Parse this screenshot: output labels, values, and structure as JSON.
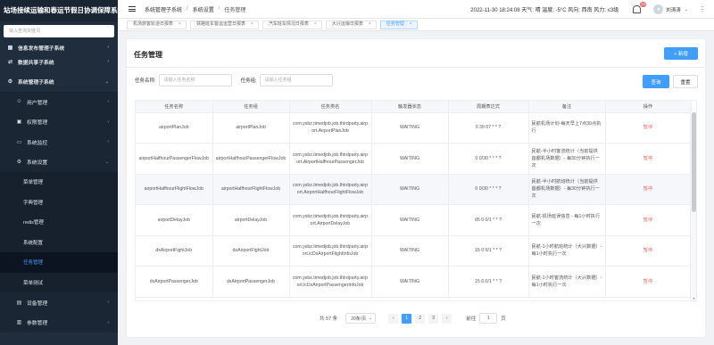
{
  "app": {
    "brand": "站场接续运输和春运节假日协调保障系统"
  },
  "sidebar": {
    "search_placeholder": "输入查询关键词",
    "items": [
      {
        "label": "信息发布管理子系统",
        "icon": "grid-icon",
        "level": 1,
        "chev": "›"
      },
      {
        "label": "数据共享子系统",
        "icon": "share-icon",
        "level": 1,
        "chev": "›"
      },
      {
        "label": "系统管理子系统",
        "icon": "gear-icon",
        "level": 1,
        "chev": "⌄"
      },
      {
        "label": "用户管理",
        "icon": "user-icon",
        "level": 2,
        "chev": "›"
      },
      {
        "label": "权限管理",
        "icon": "lock-icon",
        "level": 2,
        "chev": "›"
      },
      {
        "label": "系统监控",
        "icon": "monitor-icon",
        "level": 2,
        "chev": "›"
      },
      {
        "label": "系统设置",
        "icon": "settings-icon",
        "level": 2,
        "chev": "⌄"
      },
      {
        "label": "菜单管理",
        "level": 3
      },
      {
        "label": "字典管理",
        "level": 3
      },
      {
        "label": "redis管理",
        "level": 3
      },
      {
        "label": "系统配置",
        "level": 3
      },
      {
        "label": "任务管理",
        "level": 3,
        "active": true
      },
      {
        "label": "菜单测试",
        "level": 3
      },
      {
        "label": "设备管理",
        "icon": "device-icon",
        "level": 2,
        "chev": "›"
      },
      {
        "label": "参数管理",
        "icon": "param-icon",
        "level": 2,
        "chev": "›"
      }
    ]
  },
  "topbar": {
    "breadcrumb": [
      "系统管理子系统",
      "系统设置",
      "任务管理"
    ],
    "status": "2022-11-30 18:24:08  天气: 晴 温度: -5°C 风向: 西南 风力: ≤3级",
    "badge": "25",
    "username": "刘涛涛"
  },
  "tabs": [
    {
      "label": "机场旅客轨道日报表"
    },
    {
      "label": "铁路班车客运运营日报表"
    },
    {
      "label": "汽车班车情况日报表"
    },
    {
      "label": "大兴运输日报表"
    },
    {
      "label": "任务管理",
      "active": true
    }
  ],
  "page": {
    "title": "任务管理",
    "add_label": "+ 新增",
    "filter": {
      "name_label": "任务名称:",
      "name_placeholder": "请输入任务名称",
      "group_label": "任务组:",
      "group_placeholder": "请输入任务组",
      "query_label": "查询",
      "reset_label": "重置"
    }
  },
  "table": {
    "columns": [
      "任务名称",
      "任务组",
      "任务类名",
      "触发器状态",
      "周期表达式",
      "备注",
      "操作"
    ],
    "rows": [
      {
        "name": "airportPlanJob",
        "group": "airportPlanJob",
        "cls": "com.ysbz.timedjob.job.thirdparty.airport.AirportPlanJob",
        "state": "WAITING",
        "cron": "0 30 07 * * ?",
        "remark": "民航机场计划-每天早上7点30点执行",
        "op": "暂停"
      },
      {
        "name": "airportHalfhourPassengerFlowJob",
        "group": "airportHalfhourPassengerFlowJob",
        "cls": "com.ysbz.timedjob.job.thirdparty.airport.AirportHalfhourPassengerJob",
        "state": "WAITING",
        "cron": "0 0/30 * * * ?",
        "remark": "民航-半小时客流统计（当前提供首都机场数据）- 每30分钟执行一次",
        "op": "暂停"
      },
      {
        "name": "airportHalfhourFlightFlowJob",
        "group": "airportHalfhourFlightFlowJob",
        "cls": "com.ysbz.timedjob.job.thirdparty.airport.AirportHalfhourFlightFlowJob",
        "state": "WAITING",
        "cron": "0 0/30 * * * ?",
        "remark": "民航-半小时航班统计（当前提供首都机场数据）- 每30分钟执行一次",
        "op": "暂停",
        "hl": true
      },
      {
        "name": "airportDelayJob",
        "group": "airportDelayJob",
        "cls": "com.ysbz.timedjob.job.thirdparty.airport.AirportDelayJob",
        "state": "WAITING",
        "cron": "05 0 0/1 * * ?",
        "remark": "民航-机场延误信息 - 每1小时执行一次",
        "op": "暂停"
      },
      {
        "name": "dxAirportFightJob",
        "group": "dxAirportFightJob",
        "cls": "com.ysbz.timedjob.job.thirdparty.airport.lcDxAirportFlightInfoJob",
        "state": "WAITING",
        "cron": "15 0 0/1 * * ?",
        "remark": "民航-1小时航班统计（大兴数据）- 每1小时执行一次",
        "op": "暂停"
      },
      {
        "name": "dxAirportPassengerJob",
        "group": "dxAirportPassengerJob",
        "cls": "com.ysbz.timedjob.job.thirdparty.airport.lcDxAirportPassengerInfoJob",
        "state": "WAITING",
        "cron": "15 0 0/1 * * ?",
        "remark": "民航-1小时客流统计（大兴数据）- 每1小时执行一次",
        "op": "暂停"
      }
    ]
  },
  "pagination": {
    "total": "共 57 条",
    "page_size": "20条/页",
    "prev": "‹",
    "pages": [
      "1",
      "2",
      "3"
    ],
    "next": "›",
    "goto_label": "前往",
    "goto_value": "1",
    "page_unit": "页"
  },
  "colors": {
    "primary": "#409eff",
    "danger": "#f56c6c",
    "sidebar_bg": "#1f2d3d"
  }
}
